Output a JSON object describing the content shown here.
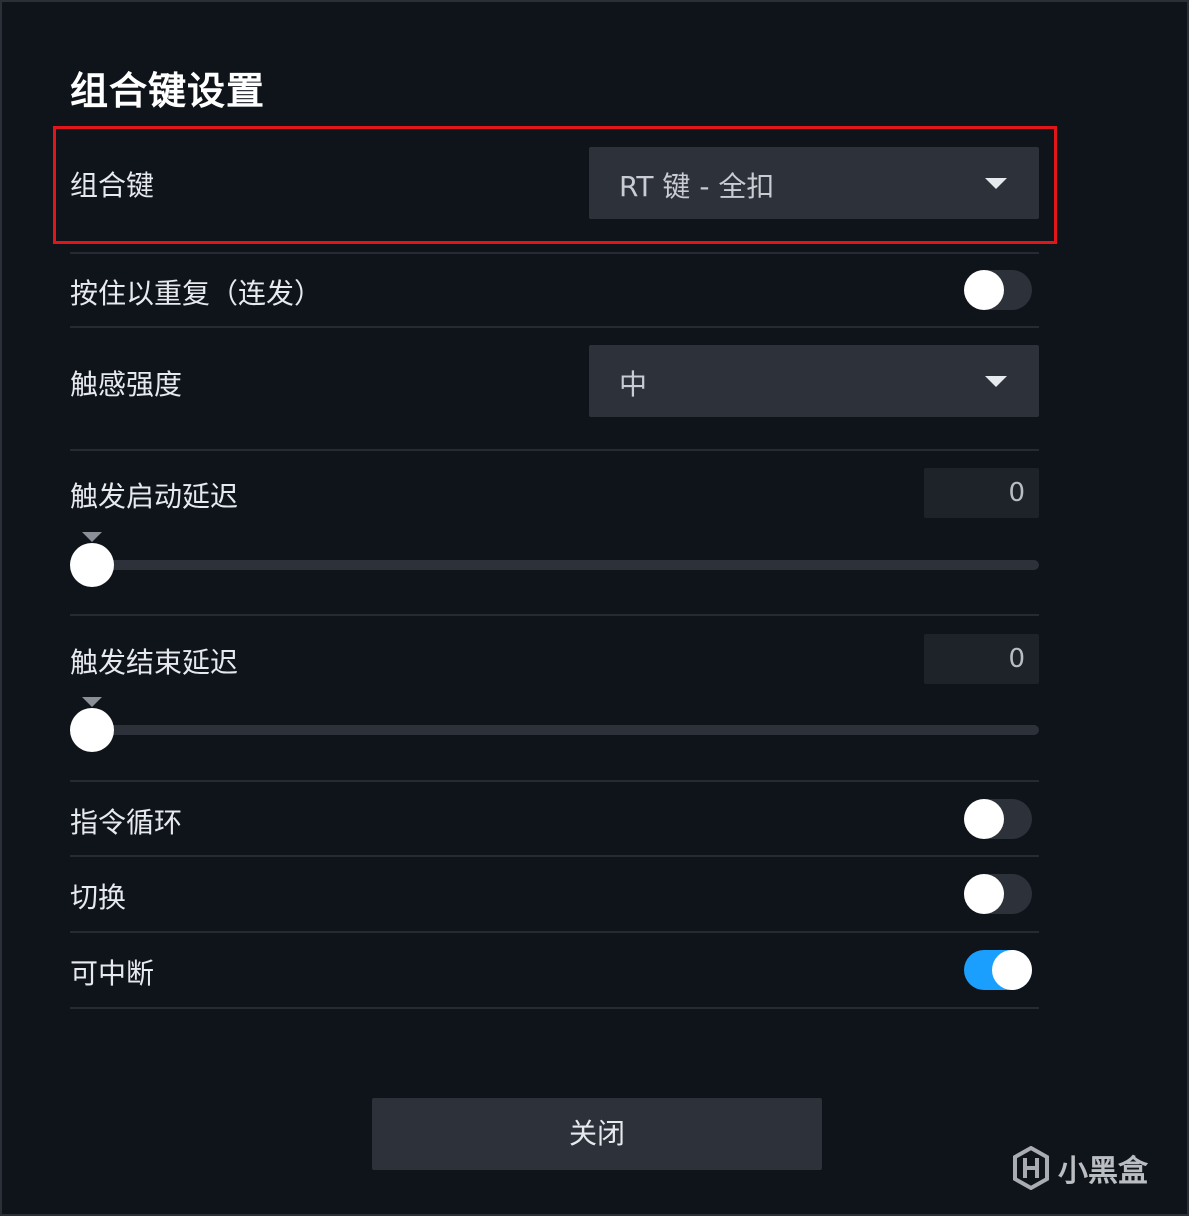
{
  "dialog": {
    "title": "组合键设置",
    "close_label": "关闭"
  },
  "rows": {
    "combo_key": {
      "label": "组合键",
      "value": "RT 键 - 全扣"
    },
    "hold_repeat": {
      "label": "按住以重复（连发）",
      "on": false
    },
    "haptic_strength": {
      "label": "触感强度",
      "value": "中"
    },
    "start_delay": {
      "label": "触发启动延迟",
      "value": "0",
      "slider_fraction": 0
    },
    "end_delay": {
      "label": "触发结束延迟",
      "value": "0",
      "slider_fraction": 0
    },
    "command_loop": {
      "label": "指令循环",
      "on": false
    },
    "toggle_mode": {
      "label": "切换",
      "on": false
    },
    "interruptible": {
      "label": "可中断",
      "on": true
    }
  },
  "colors": {
    "background": "#0f131a",
    "control": "#2d3139",
    "toggle_on": "#1a9fff",
    "highlight": "#e0161b"
  },
  "watermark": {
    "text": "小黑盒",
    "icon": "xiaoheihe-logo-icon"
  }
}
